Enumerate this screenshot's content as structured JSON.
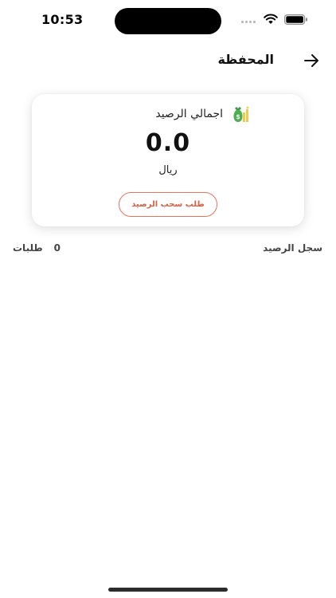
{
  "status_bar": {
    "time": "10:53"
  },
  "header": {
    "title": "المحفظة"
  },
  "balance_card": {
    "label": "اجمالي الرصيد",
    "amount": "0.0",
    "currency": "ريال",
    "withdraw_label": "طلب سحب الرصيد"
  },
  "history": {
    "title": "سجل الرصيد",
    "count": "0",
    "count_label": "طلبات"
  },
  "colors": {
    "accent": "#e8735b",
    "money_icon": "#4caf50"
  },
  "icons": {
    "back": "arrow-right-icon",
    "money": "money-bag-icon",
    "wifi": "wifi-icon",
    "battery": "battery-icon"
  }
}
